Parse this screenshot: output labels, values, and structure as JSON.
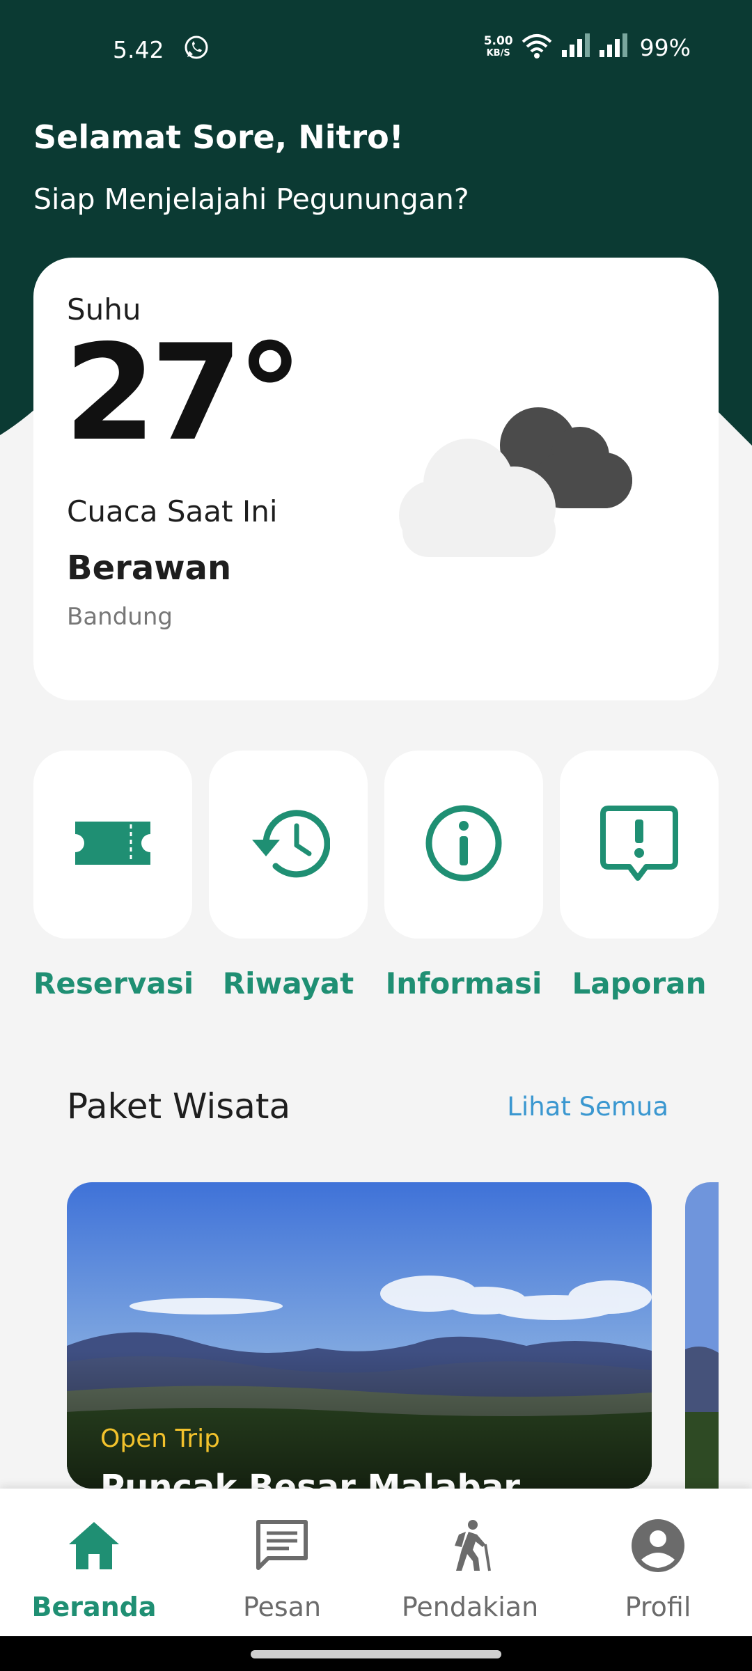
{
  "status_bar": {
    "time": "5.42",
    "net_speed_value": "5.00",
    "net_speed_unit": "KB/S",
    "battery": "99%"
  },
  "header": {
    "greeting": "Selamat Sore, Nitro!",
    "subtitle": "Siap Menjelajahi Pegunungan?"
  },
  "weather": {
    "temp_label": "Suhu",
    "temperature": "27°",
    "condition_label": "Cuaca Saat Ini",
    "condition": "Berawan",
    "city": "Bandung",
    "icon": "cloudy-night-icon"
  },
  "menu": [
    {
      "label": "Reservasi",
      "icon": "ticket-icon"
    },
    {
      "label": "Riwayat",
      "icon": "history-icon"
    },
    {
      "label": "Informasi",
      "icon": "info-icon"
    },
    {
      "label": "Laporan",
      "icon": "report-icon"
    }
  ],
  "packages": {
    "title": "Paket Wisata",
    "see_all": "Lihat Semua",
    "items": [
      {
        "tag": "Open Trip",
        "name": "Puncak Besar Malabar"
      }
    ]
  },
  "bottom_nav": [
    {
      "label": "Beranda",
      "icon": "home-icon",
      "active": true
    },
    {
      "label": "Pesan",
      "icon": "message-icon",
      "active": false
    },
    {
      "label": "Pendakian",
      "icon": "hiker-icon",
      "active": false
    },
    {
      "label": "Profil",
      "icon": "profile-icon",
      "active": false
    }
  ],
  "colors": {
    "header_bg": "#0b3a33",
    "accent": "#1f8f73",
    "link": "#3a97d0",
    "tag": "#f2c22c"
  }
}
